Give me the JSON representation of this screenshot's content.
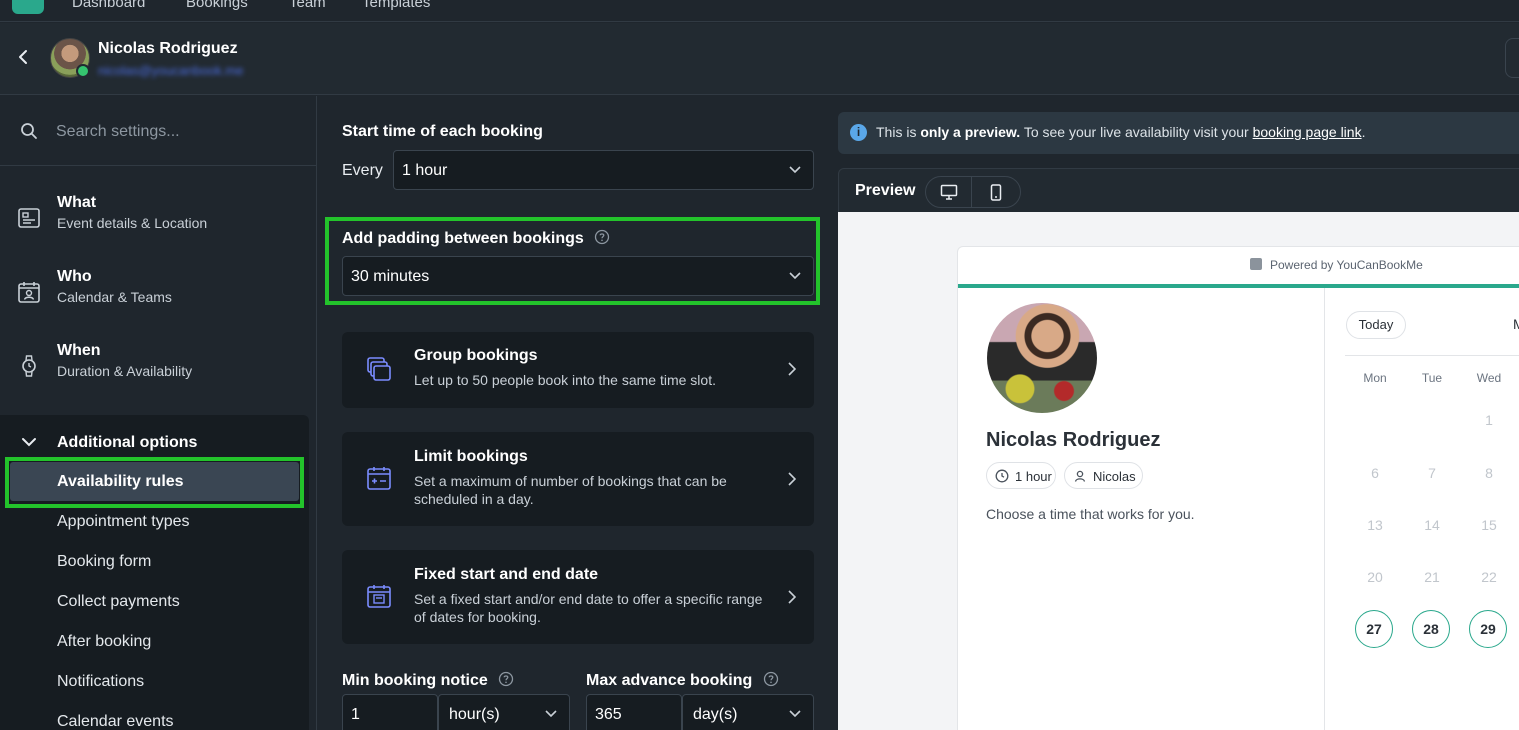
{
  "nav": {
    "links": [
      "Dashboard",
      "Bookings",
      "Team",
      "Templates"
    ]
  },
  "header": {
    "user_name": "Nicolas Rodriguez",
    "user_email": "nicolas@youcanbook.me"
  },
  "sidebar": {
    "search_placeholder": "Search settings...",
    "sections": [
      {
        "title": "What",
        "subtitle": "Event details & Location",
        "icon": "id-card-icon"
      },
      {
        "title": "Who",
        "subtitle": "Calendar & Teams",
        "icon": "calendar-contact-icon"
      },
      {
        "title": "When",
        "subtitle": "Duration & Availability",
        "icon": "watch-icon"
      }
    ],
    "additional": {
      "title": "Additional options",
      "items": [
        "Availability rules",
        "Appointment types",
        "Booking form",
        "Collect payments",
        "After booking",
        "Notifications",
        "Calendar events"
      ],
      "active": "Availability rules"
    }
  },
  "main": {
    "start_time": {
      "label": "Start time of each booking",
      "prefix": "Every",
      "value": "1 hour"
    },
    "padding": {
      "label": "Add padding between bookings",
      "value": "30 minutes"
    },
    "cards": [
      {
        "title": "Group bookings",
        "desc": "Let up to 50 people book into the same time slot.",
        "icon": "group-stack-icon"
      },
      {
        "title": "Limit bookings",
        "desc": "Set a maximum of number of bookings that can be scheduled in a day.",
        "icon": "calendar-limit-icon"
      },
      {
        "title": "Fixed start and end date",
        "desc": "Set a fixed start and/or end date to offer a specific range of dates for booking.",
        "icon": "calendar-fixed-icon"
      }
    ],
    "min_notice": {
      "label": "Min booking notice",
      "value": "1",
      "unit": "hour(s)"
    },
    "max_advance": {
      "label": "Max advance booking",
      "value": "365",
      "unit": "day(s)"
    }
  },
  "preview": {
    "notice_pre": "This is ",
    "notice_bold": "only a preview.",
    "notice_mid": " To see your live availability visit your ",
    "notice_link": "booking page link",
    "notice_end": ".",
    "label": "Preview",
    "powered_by": "Powered by YouCanBookMe",
    "name": "Nicolas Rodriguez",
    "duration_chip": "1 hour",
    "host_chip": "Nicolas",
    "choose_text": "Choose a time that works for you.",
    "today_label": "Today",
    "month_partial": "M",
    "weekdays": [
      "Mon",
      "Tue",
      "Wed"
    ],
    "weeks": [
      [
        "",
        "",
        "1"
      ],
      [
        "6",
        "7",
        "8"
      ],
      [
        "13",
        "14",
        "15"
      ],
      [
        "20",
        "21",
        "22"
      ],
      [
        "27",
        "28",
        "29"
      ]
    ],
    "available_days": [
      "27",
      "28",
      "29"
    ]
  },
  "colors": {
    "accent": "#2aa88c",
    "highlight": "#23c32b",
    "bg_dark": "#1f262d"
  }
}
